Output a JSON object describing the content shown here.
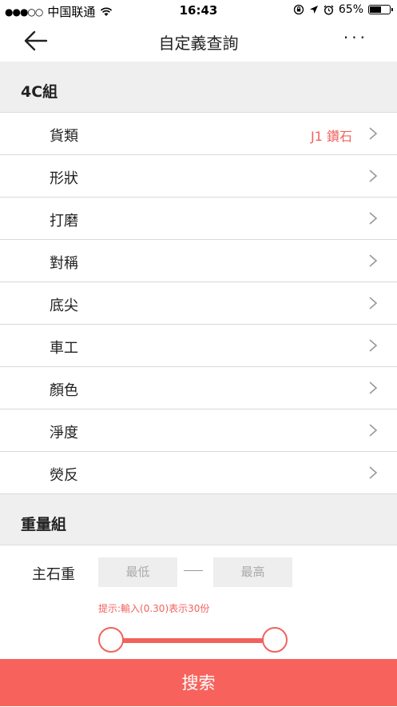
{
  "status_bar": {
    "signal": "●●●○○",
    "carrier": "中国联通",
    "time": "16:43",
    "battery_percent": "65%",
    "battery_level": 0.65
  },
  "nav": {
    "title": "自定義查詢",
    "more": "···"
  },
  "section_4c": {
    "title": "4C組",
    "rows": [
      {
        "label": "貨類",
        "value": "J1 鑽石"
      },
      {
        "label": "形狀",
        "value": ""
      },
      {
        "label": "打磨",
        "value": ""
      },
      {
        "label": "對稱",
        "value": ""
      },
      {
        "label": "底尖",
        "value": ""
      },
      {
        "label": "車工",
        "value": ""
      },
      {
        "label": "顏色",
        "value": ""
      },
      {
        "label": "淨度",
        "value": ""
      },
      {
        "label": "熒反",
        "value": ""
      }
    ]
  },
  "section_weight": {
    "title": "重量組",
    "main_stone_label": "主石重",
    "min_placeholder": "最低",
    "max_placeholder": "最高",
    "hint": "提示:輸入(0.30)表示30份"
  },
  "search_button": "搜索",
  "colors": {
    "accent": "#f7635c",
    "section_bg": "#efefef"
  }
}
